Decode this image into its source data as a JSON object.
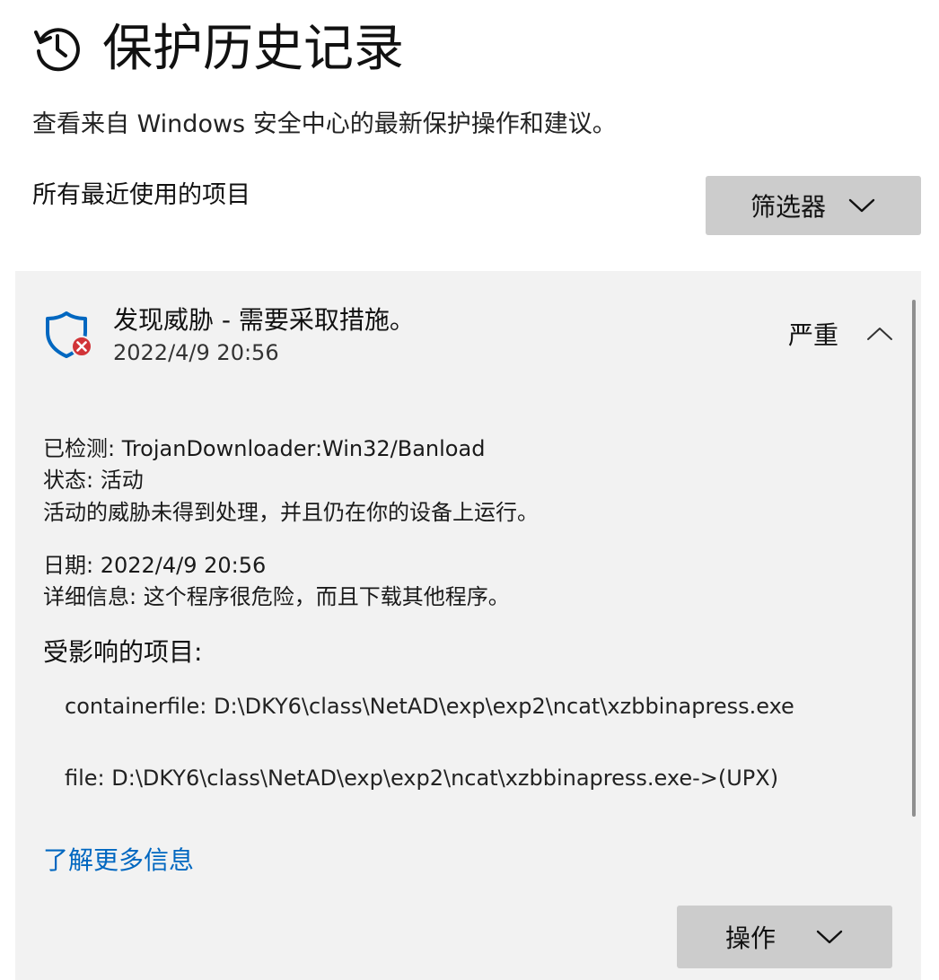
{
  "header": {
    "icon": "history-clock-icon",
    "title": "保护历史记录",
    "subtitle": "查看来自 Windows 安全中心的最新保护操作和建议。"
  },
  "list": {
    "label": "所有最近使用的项目",
    "filter_label": "筛选器"
  },
  "threat": {
    "icon": "shield-threat-icon",
    "title": "发现威胁 - 需要采取措施。",
    "time": "2022/4/9 20:56",
    "severity": "严重",
    "detected": "已检测:  TrojanDownloader:Win32/Banload",
    "status": "状态:  活动",
    "status_note": "活动的威胁未得到处理，并且仍在你的设备上运行。",
    "date": "日期:  2022/4/9 20:56",
    "details": "详细信息:  这个程序很危险，而且下载其他程序。",
    "affected_heading": "受影响的项目:",
    "affected_items": [
      "containerfile: D:\\DKY6\\class\\NetAD\\exp\\exp2\\ncat\\xzbbinapress.exe",
      "file: D:\\DKY6\\class\\NetAD\\exp\\exp2\\ncat\\xzbbinapress.exe->(UPX)"
    ],
    "learn_more": "了解更多信息",
    "action_label": "操作"
  },
  "colors": {
    "link": "#0067c0",
    "shield": "#0067c0",
    "danger": "#d13438",
    "card_bg": "#f2f2f2",
    "button_bg": "#cccccc"
  }
}
